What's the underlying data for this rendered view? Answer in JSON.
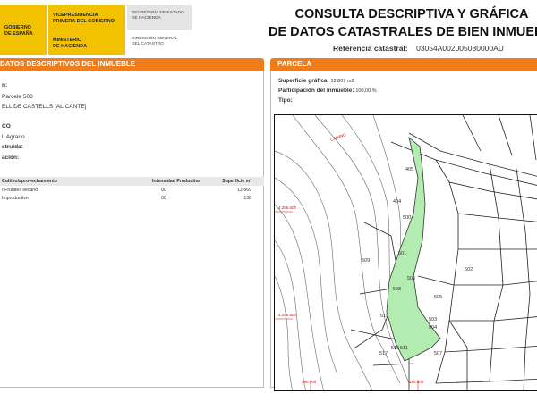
{
  "header": {
    "gov_logo_lines": [
      "GOBIERNO",
      "DE ESPAÑA"
    ],
    "vice_lines": [
      "VICEPRESIDENCIA",
      "PRIMERA DEL GOBIERNO"
    ],
    "ministry_lines": [
      "MINISTERIO",
      "DE HACIENDA"
    ],
    "secretaria_lines": [
      "SECRETARÍA DE ESTADO",
      "DE HACIENDA"
    ],
    "direccion_lines": [
      "DIRECCIÓN GENERAL",
      "DEL CATASTRO"
    ],
    "brand_yellow": "#f2c200",
    "title_line1": "CONSULTA DESCRIPTIVA Y GRÁFICA",
    "title_line2": "DE DATOS CATASTRALES DE BIEN INMUEBLE",
    "ref_label": "Referencia catastral:",
    "ref_value": "03054A002005080000AU"
  },
  "section_color": "#f07d1c",
  "left": {
    "bar_title": "DATOS DESCRIPTIVOS DEL INMUEBLE",
    "lines": [
      "n:",
      "Parcela 508",
      "ELL DE CASTELLS [ALICANTE]",
      "CO",
      "l:  Agrario",
      "struida:",
      "ación:"
    ],
    "table": {
      "headers": [
        "Cultivo/aprovechamiento",
        "Intensidad Productiva",
        "Superficie m²"
      ],
      "rows": [
        [
          "r Frutales secano",
          "00",
          "12.669"
        ],
        [
          "Improductivo",
          "00",
          "138"
        ]
      ]
    }
  },
  "right": {
    "bar_title": "PARCELA",
    "sup_label": "Superficie gráfica:",
    "sup_value": "12.807 m2",
    "part_label": "Participación del inmueble:",
    "part_value": "100,00 %",
    "tipo_label": "Tipo:"
  },
  "map": {
    "parcel_fill": "#b3ecb0",
    "numbers": [
      "405",
      "404",
      "500",
      "501",
      "502",
      "503",
      "504",
      "505",
      "506",
      "508",
      "509",
      "511",
      "515",
      "516",
      "517",
      "507"
    ],
    "red_labels": [
      "4.296.600",
      "4.296.800",
      "CAMINO",
      "190.400",
      "190.600"
    ]
  }
}
